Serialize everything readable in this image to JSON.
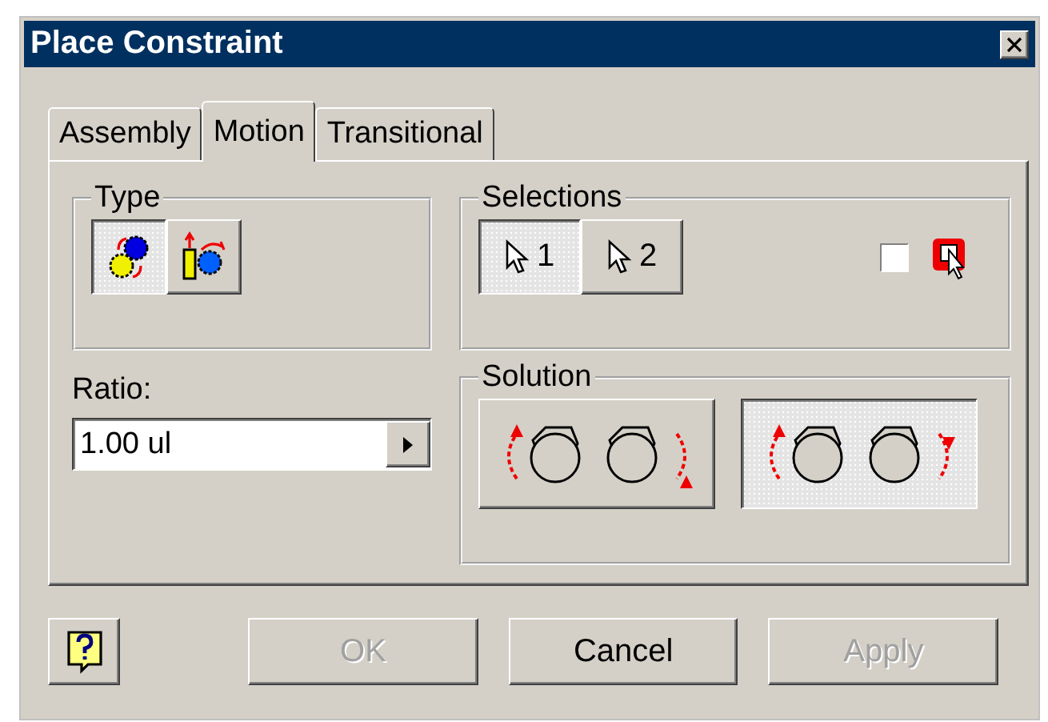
{
  "window": {
    "title": "Place Constraint"
  },
  "tabs": [
    {
      "label": "Assembly",
      "selected": false
    },
    {
      "label": "Motion",
      "selected": true
    },
    {
      "label": "Transitional",
      "selected": false
    }
  ],
  "type_group": {
    "title": "Type",
    "options": [
      {
        "kind": "rotation",
        "selected": true
      },
      {
        "kind": "translation",
        "selected": false
      }
    ]
  },
  "ratio": {
    "label": "Ratio:",
    "value": "1.00 ul"
  },
  "selections": {
    "title": "Selections",
    "buttons": [
      {
        "label": "1",
        "selected": true
      },
      {
        "label": "2",
        "selected": false
      }
    ],
    "checkbox": {
      "checked": false
    }
  },
  "solution": {
    "title": "Solution",
    "options": [
      {
        "kind": "forward",
        "selected": false
      },
      {
        "kind": "reverse",
        "selected": true
      }
    ]
  },
  "buttons": [
    {
      "label": "OK",
      "disabled": true
    },
    {
      "label": "Cancel",
      "disabled": false
    },
    {
      "label": "Apply",
      "disabled": true
    }
  ]
}
